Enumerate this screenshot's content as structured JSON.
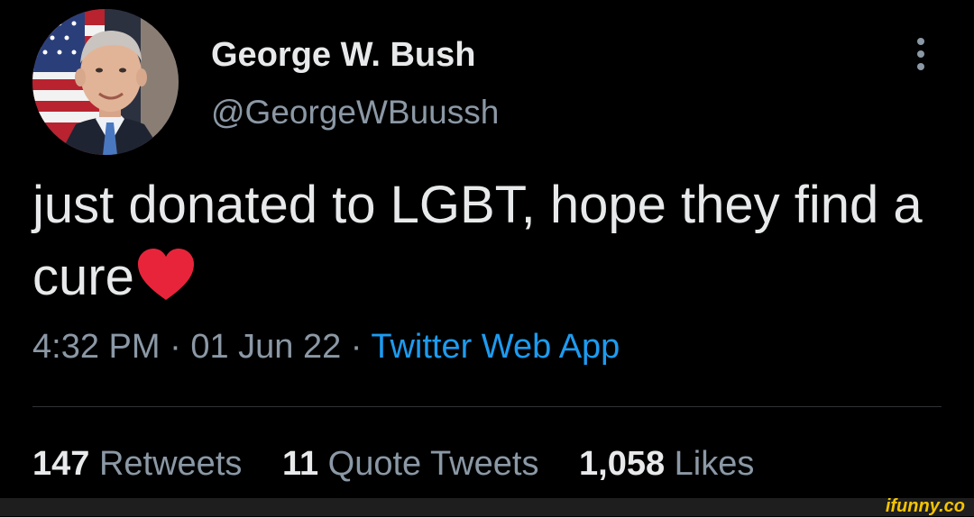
{
  "author": {
    "display_name": "George W. Bush",
    "handle": "@GeorgeWBuussh"
  },
  "tweet": {
    "text": "just donated to LGBT, hope they find a cure",
    "emoji": "red-heart"
  },
  "meta": {
    "time": "4:32 PM",
    "separator": "·",
    "date": "01 Jun 22",
    "source": "Twitter Web App"
  },
  "stats": {
    "retweets_count": "147",
    "retweets_label": "Retweets",
    "quotes_count": "11",
    "quotes_label": "Quote Tweets",
    "likes_count": "1,058",
    "likes_label": "Likes"
  },
  "watermark": "ifunny.co",
  "colors": {
    "background": "#000000",
    "primary_text": "#e7e9ea",
    "secondary_text": "#8b98a5",
    "link": "#1d9bf0",
    "heart": "#e8243b",
    "watermark": "#f5c400"
  },
  "icons": {
    "more": "more-vertical-icon",
    "heart": "red-heart-emoji"
  }
}
